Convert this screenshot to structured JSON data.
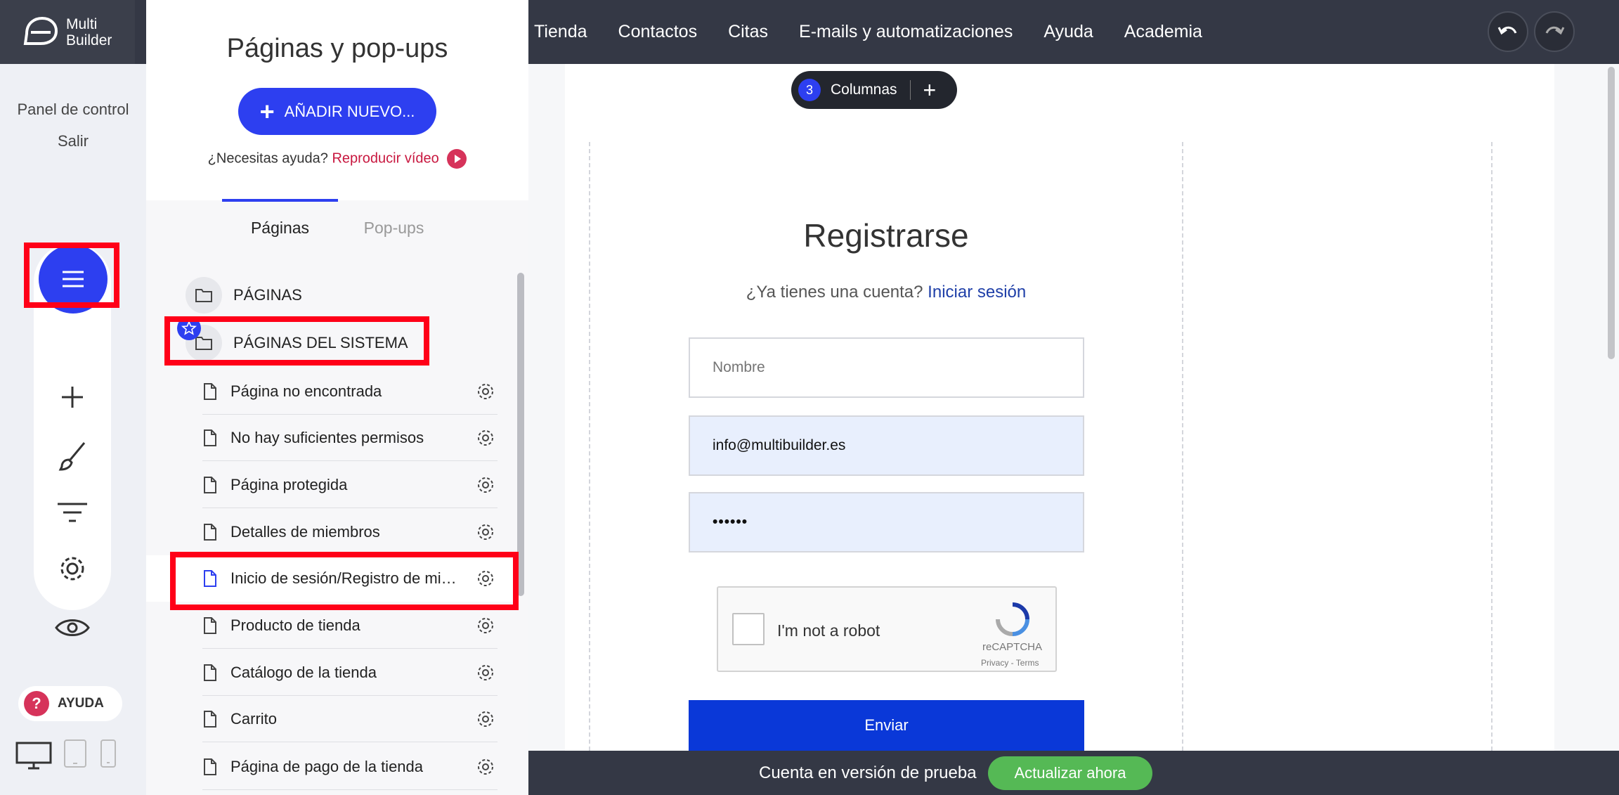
{
  "app": {
    "logo_line1": "Multi",
    "logo_line2": "Builder"
  },
  "topnav": {
    "items": [
      "Tienda",
      "Contactos",
      "Citas",
      "E-mails y automatizaciones",
      "Ayuda",
      "Academia"
    ]
  },
  "leftrail": {
    "dashboard_link": "Panel de control",
    "logout_link": "Salir",
    "help_label": "AYUDA",
    "tools": [
      "menu-icon",
      "plus-icon",
      "brush-icon",
      "filter-icon",
      "gear-icon",
      "eye-icon"
    ],
    "devices": [
      "desktop-icon",
      "tablet-icon",
      "mobile-icon"
    ]
  },
  "panel": {
    "title": "Páginas y pop-ups",
    "add_new_label": "AÑADIR NUEVO...",
    "help_question": "¿Necesitas ayuda?",
    "help_video_link": "Reproducir vídeo",
    "tabs": [
      "Páginas",
      "Pop-ups"
    ],
    "active_tab": "Páginas",
    "folders": [
      "PÁGINAS",
      "PÁGINAS DEL SISTEMA"
    ],
    "pages": [
      "Página no encontrada",
      "No hay suficientes permisos",
      "Página protegida",
      "Detalles de miembros",
      "Inicio de sesión/Registro de miembros",
      "Producto de tienda",
      "Catálogo de la tienda",
      "Carrito",
      "Página de pago de la tienda"
    ],
    "selected_page": "Inicio de sesión/Registro de miembros"
  },
  "canvas": {
    "columns_count": "3",
    "columns_label": "Columnas",
    "form": {
      "title": "Registrarse",
      "have_account": "¿Ya tienes una cuenta?",
      "login_link": "Iniciar sesión",
      "name_placeholder": "Nombre",
      "email_value": "info@multibuilder.es",
      "password_value": "••••••",
      "captcha_label": "I'm not a robot",
      "captcha_brand": "reCAPTCHA",
      "captcha_terms": "Privacy - Terms",
      "submit_label": "Enviar"
    }
  },
  "bottombar": {
    "trial_text": "Cuenta en versión de prueba",
    "upgrade_label": "Actualizar ahora"
  },
  "colors": {
    "accent": "#2d3ff0",
    "topbar": "#343845",
    "highlight": "#ff0018",
    "upgrade": "#55b955",
    "submit": "#0a38d8"
  }
}
